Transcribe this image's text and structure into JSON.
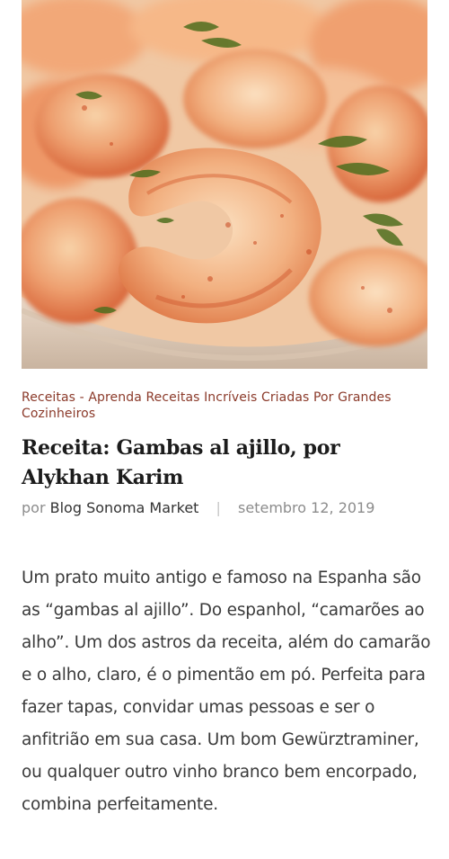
{
  "hero": {
    "image_name": "garlic-shrimp-photo"
  },
  "post": {
    "category": "Receitas - Aprenda Receitas Incríveis Criadas Por Grandes Cozinheiros",
    "title": "Receita: Gambas al ajillo, por Alykhan Karim",
    "by_label": "por",
    "author": "Blog Sonoma Market",
    "separator": "|",
    "date": "setembro 12, 2019",
    "body": "Um prato muito antigo e famoso na Espanha são as “gambas al ajillo”. Do espanhol, “camarões ao alho”. Um dos astros da receita, além do camarão e o alho, claro, é o pimentão em pó. Perfeita para fazer tapas, convidar umas pessoas e ser o anfitrião em sua casa. Um bom Gewürztraminer, ou qualquer outro vinho branco bem encorpado, combina perfeitamente."
  },
  "colors": {
    "category": "#8b3a2a",
    "title": "#1c1c1c",
    "meta": "#8c8c8c",
    "author": "#333333",
    "body": "#3a3a3a"
  }
}
